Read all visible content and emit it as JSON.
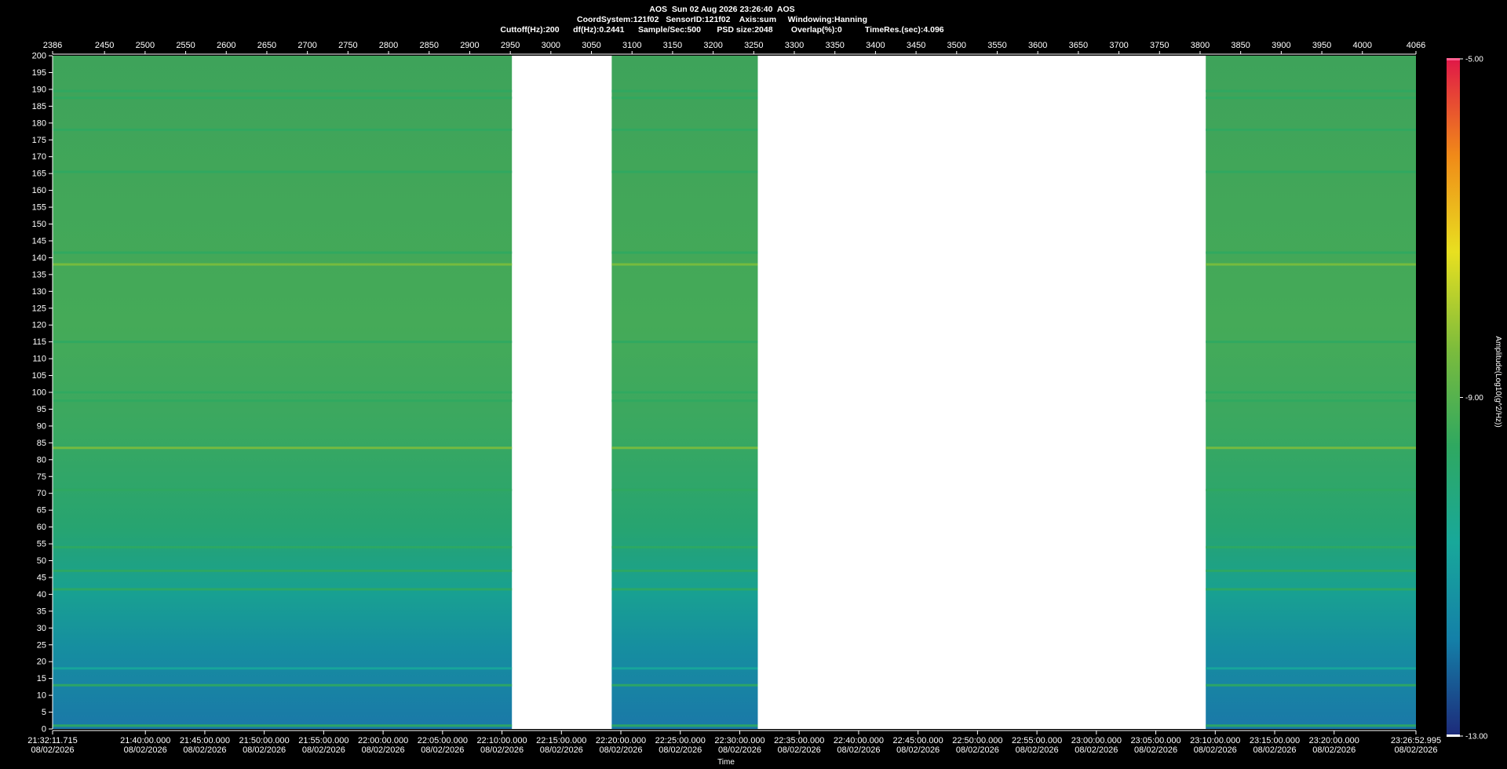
{
  "header": {
    "line1": "AOS  Sun 02 Aug 2026 23:26:40  AOS",
    "line2": "CoordSystem:121f02   SensorID:121f02    Axis:sum     Windowing:Hanning",
    "line3": "Cuttoff(Hz):200      df(Hz):0.2441      Sample/Sec:500       PSD size:2048        Overlap(%):0          TimeRes.(sec):4.096"
  },
  "chart_data": {
    "type": "heatmap",
    "xlabel": "Time",
    "ylabel": "",
    "colorbar_label": "Amplitude(Log10(g^2/Hz))",
    "colorbar_ticks": [
      "-5.00",
      "-9.00",
      "-13.00"
    ],
    "colorbar_range": [
      -13,
      -5
    ],
    "colors": {
      "background": "#000000",
      "gap": "#ffffff",
      "scale": [
        "#1d2a7a",
        "#1480a8",
        "#18a89a",
        "#2fa860",
        "#7cbc3c",
        "#e8e020",
        "#f08a18",
        "#e01848"
      ]
    },
    "ylim": [
      0,
      200
    ],
    "yticks": [
      200,
      195,
      190,
      185,
      180,
      175,
      170,
      165,
      160,
      155,
      150,
      145,
      140,
      135,
      130,
      125,
      120,
      115,
      110,
      105,
      100,
      95,
      90,
      85,
      80,
      75,
      70,
      65,
      60,
      55,
      50,
      45,
      40,
      35,
      30,
      25,
      20,
      15,
      10,
      5,
      0
    ],
    "top_axis_range": [
      2386,
      4066
    ],
    "top_ticks": [
      "2386",
      "2450",
      "2500",
      "2550",
      "2600",
      "2650",
      "2700",
      "2750",
      "2800",
      "2850",
      "2900",
      "2950",
      "3000",
      "3050",
      "3100",
      "3150",
      "3200",
      "3250",
      "3300",
      "3350",
      "3400",
      "3450",
      "3500",
      "3550",
      "3600",
      "3650",
      "3700",
      "3750",
      "3800",
      "3850",
      "3900",
      "3950",
      "4000",
      "4066"
    ],
    "time_ticks": [
      {
        "time": "21:32:11.715",
        "date": "08/02/2026"
      },
      {
        "time": "21:40:00.000",
        "date": "08/02/2026"
      },
      {
        "time": "21:45:00.000",
        "date": "08/02/2026"
      },
      {
        "time": "21:50:00.000",
        "date": "08/02/2026"
      },
      {
        "time": "21:55:00.000",
        "date": "08/02/2026"
      },
      {
        "time": "22:00:00.000",
        "date": "08/02/2026"
      },
      {
        "time": "22:05:00.000",
        "date": "08/02/2026"
      },
      {
        "time": "22:10:00.000",
        "date": "08/02/2026"
      },
      {
        "time": "22:15:00.000",
        "date": "08/02/2026"
      },
      {
        "time": "22:20:00.000",
        "date": "08/02/2026"
      },
      {
        "time": "22:25:00.000",
        "date": "08/02/2026"
      },
      {
        "time": "22:30:00.000",
        "date": "08/02/2026"
      },
      {
        "time": "22:35:00.000",
        "date": "08/02/2026"
      },
      {
        "time": "22:40:00.000",
        "date": "08/02/2026"
      },
      {
        "time": "22:45:00.000",
        "date": "08/02/2026"
      },
      {
        "time": "22:50:00.000",
        "date": "08/02/2026"
      },
      {
        "time": "22:55:00.000",
        "date": "08/02/2026"
      },
      {
        "time": "23:00:00.000",
        "date": "08/02/2026"
      },
      {
        "time": "23:05:00.000",
        "date": "08/02/2026"
      },
      {
        "time": "23:10:00.000",
        "date": "08/02/2026"
      },
      {
        "time": "23:15:00.000",
        "date": "08/02/2026"
      },
      {
        "time": "23:20:00.000",
        "date": "08/02/2026"
      },
      {
        "time": "23:26:52.995",
        "date": "08/02/2026"
      }
    ],
    "data_segments": [
      {
        "start": 2386,
        "end": 2952
      },
      {
        "start": 3075,
        "end": 3255
      },
      {
        "start": 3807,
        "end": 4066
      }
    ],
    "bright_bands_hz": [
      {
        "hz": 1,
        "level": -9.5
      },
      {
        "hz": 13,
        "level": -9.6
      },
      {
        "hz": 18,
        "level": -10.6
      },
      {
        "hz": 41.5,
        "level": -9.4
      },
      {
        "hz": 47,
        "level": -9.6
      },
      {
        "hz": 54,
        "level": -9.8
      },
      {
        "hz": 71,
        "level": -9.9
      },
      {
        "hz": 83.5,
        "level": -8.4
      },
      {
        "hz": 97.5,
        "level": -9.3
      },
      {
        "hz": 100,
        "level": -9.6
      },
      {
        "hz": 115,
        "level": -9.9
      },
      {
        "hz": 138,
        "level": -9.0
      },
      {
        "hz": 141.5,
        "level": -9.4
      },
      {
        "hz": 165.5,
        "level": -9.4
      },
      {
        "hz": 178,
        "level": -9.2
      },
      {
        "hz": 187.5,
        "level": -9.4
      },
      {
        "hz": 189.5,
        "level": -9.4
      }
    ]
  }
}
